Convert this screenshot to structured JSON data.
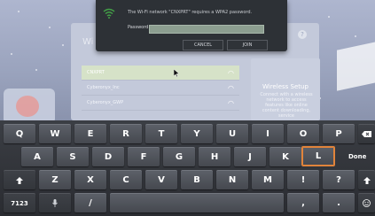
{
  "setup": {
    "title": "Wi",
    "networks": [
      {
        "name": "CNXPRT",
        "selected": true
      },
      {
        "name": "Cyberonyx_Inc",
        "selected": false
      },
      {
        "name": "Cyberonyx_GWP",
        "selected": false
      }
    ],
    "info_title": "Wireless Setup",
    "info_text": "Connect with a wireless network to access features like online content downloading, service",
    "help": "?"
  },
  "dialog": {
    "message": "The Wi-Fi network \"CNXPRT\" requires a WPA2 password.",
    "password_label": "Password",
    "password_value": "",
    "cancel_label": "CANCEL",
    "join_label": "JOIN",
    "accent_color": "#43a047"
  },
  "keyboard": {
    "row1": [
      "Q",
      "W",
      "E",
      "R",
      "T",
      "Y",
      "U",
      "I",
      "O",
      "P"
    ],
    "row2": [
      "A",
      "S",
      "D",
      "F",
      "G",
      "H",
      "J",
      "K",
      "L"
    ],
    "row3": [
      "Z",
      "X",
      "C",
      "V",
      "B",
      "N",
      "M",
      "!",
      "?"
    ],
    "focused_key": "L",
    "done_label": "Done",
    "symbols_label": "7123",
    "slash": "/",
    "comma": ",",
    "period": ".",
    "icons": {
      "shift": "shift-icon",
      "backspace": "backspace-icon",
      "mic": "mic-icon",
      "emoji": "emoji-icon"
    }
  }
}
